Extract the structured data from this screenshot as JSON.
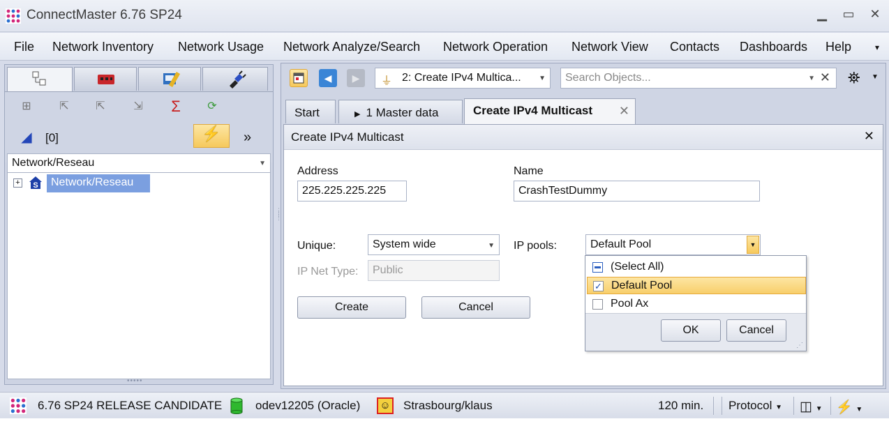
{
  "window": {
    "title": "ConnectMaster 6.76 SP24",
    "minimize_icon": "minimize-icon",
    "maximize_icon": "maximize-icon",
    "close_icon": "close-icon"
  },
  "menu": {
    "items": [
      "File",
      "Network Inventory",
      "Network Usage",
      "Network Analyze/Search",
      "Network Operation",
      "Network View",
      "Contacts",
      "Dashboards",
      "Help"
    ],
    "overflow_icon": "chevron-down-icon"
  },
  "left_panel": {
    "tabs": [
      "tree-view-icon",
      "network-device-icon",
      "tools-icon",
      "plug-icon"
    ],
    "toolbar_icons": [
      "add-node-icon",
      "move-up-icon",
      "move-up-alt-icon",
      "move-down-icon",
      "sum-icon",
      "refresh-icon"
    ],
    "filter_count": "[0]",
    "more_label": "»",
    "combo_value": "Network/Reseau",
    "tree": [
      {
        "label": "Network/Reseau",
        "expanded": false,
        "selected": true
      }
    ]
  },
  "right_panel": {
    "object_combo": "2: Create IPv4 Multica...",
    "search_placeholder": "Search Objects...",
    "tabs": [
      {
        "label": "Start",
        "active": false
      },
      {
        "label": "1 Master data",
        "active": false
      },
      {
        "label": "Create IPv4 Multicast",
        "active": true
      }
    ],
    "form": {
      "title": "Create IPv4 Multicast",
      "address_label": "Address",
      "address_value": "225.225.225.225",
      "name_label": "Name",
      "name_value": "CrashTestDummy",
      "unique_label": "Unique:",
      "unique_value": "System wide",
      "ip_net_type_label": "IP Net Type:",
      "ip_net_type_value": "Public",
      "ip_pools_label": "IP pools:",
      "ip_pools_value": "Default Pool",
      "create_label": "Create",
      "cancel_label": "Cancel"
    },
    "pools_popup": {
      "items": [
        {
          "label": "(Select All)",
          "state": "partial"
        },
        {
          "label": "Default Pool",
          "state": "checked",
          "selected": true
        },
        {
          "label": "Pool Ax",
          "state": "unchecked"
        }
      ],
      "ok_label": "OK",
      "cancel_label": "Cancel"
    }
  },
  "statusbar": {
    "version": "6.76 SP24 RELEASE CANDIDATE",
    "database": "odev12205 (Oracle)",
    "user": "Strasbourg/klaus",
    "timeout": "120 min.",
    "protocol_label": "Protocol"
  },
  "colors": {
    "accent_selection": "#7b9fe0",
    "highlight_orange": "#f8cf6b",
    "frame": "#cfd5e4"
  }
}
